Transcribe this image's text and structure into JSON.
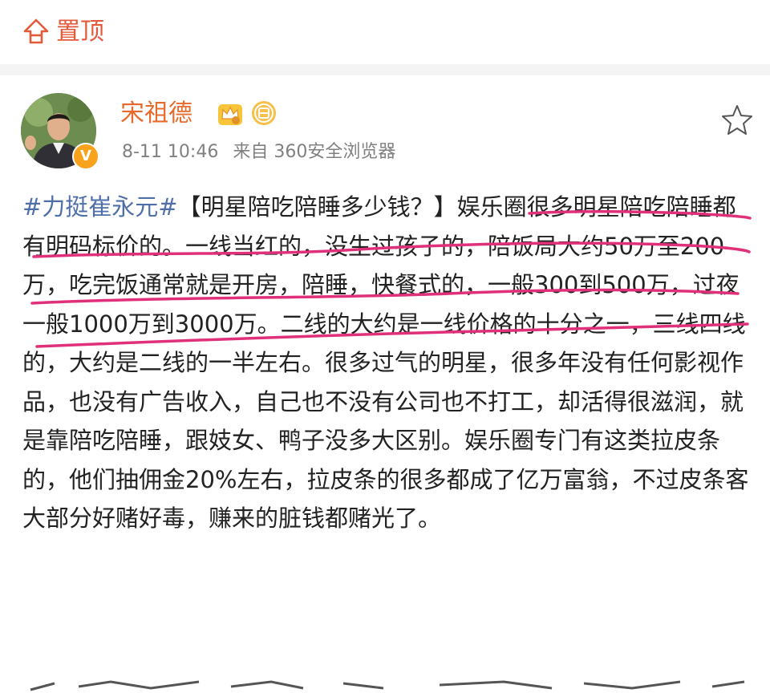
{
  "top_bar": {
    "pin_label": "置顶",
    "pin_icon": "pin-to-top-icon",
    "accent_color": "#e35a3a"
  },
  "post": {
    "author": {
      "name": "宋祖德",
      "name_color": "#e86a2c",
      "verified_badge": "V",
      "badge_icons": [
        "crown-vip-icon",
        "fan-badge-icon"
      ]
    },
    "meta": {
      "timestamp": "8-11 10:46",
      "source": "来自 360安全浏览器"
    },
    "actions": {
      "favorite_icon": "star-icon"
    },
    "hashtag": "#力挺崔永元#",
    "body": "【明星陪吃陪睡多少钱？】娱乐圈很多明星陪吃陪睡都有明码标价的。一线当红的，没生过孩子的，陪饭局大约50万至200万，吃完饭通常就是开房，陪睡，快餐式的，一般300到500万，过夜一般1000万到3000万。二线的大约是一线价格的十分之一，三线四线的，大约是二线的一半左右。很多过气的明星，很多年没有任何影视作品，也没有广告收入，自己也不没有公司也不打工，却活得很滋润，就是靠陪吃陪睡，跟妓女、鸭子没多大区别。娱乐圈专门有这类拉皮条的，他们抽佣金20%左右，拉皮条的很多都成了亿万富翁，不过皮条客大部分好赌好毒，赚来的脏钱都赌光了。",
    "hashtag_color": "#4e6fa8",
    "highlight_color": "#e0307a"
  }
}
